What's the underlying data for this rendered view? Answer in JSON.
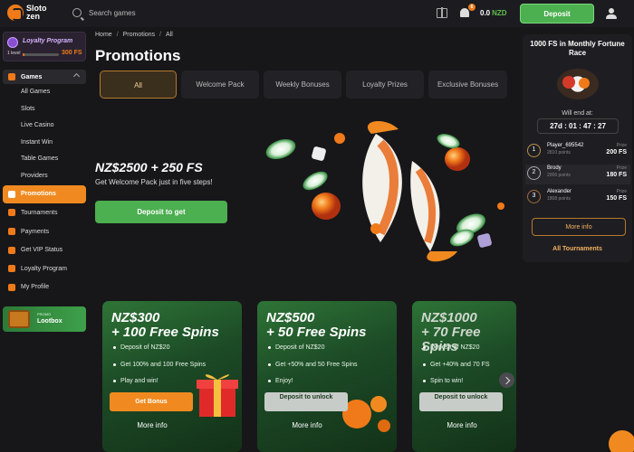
{
  "header": {
    "logo_text": "Sloto zen",
    "search_placeholder": "Search games",
    "notification_count": "6",
    "balance_amount": "0.0",
    "balance_currency": "NZD",
    "deposit_label": "Deposit"
  },
  "loyalty": {
    "title": "Loyalty Program",
    "level": "1 level",
    "points": "300 FS",
    "progress_fraction": 0.05
  },
  "sidebar": {
    "games_label": "Games",
    "game_items": [
      "All Games",
      "Slots",
      "Live Casino",
      "Instant Win",
      "Table Games",
      "Providers"
    ],
    "items": [
      {
        "label": "Promotions",
        "active": true
      },
      {
        "label": "Tournaments",
        "active": false
      },
      {
        "label": "Payments",
        "active": false
      },
      {
        "label": "Get VIP Status",
        "active": false
      },
      {
        "label": "Loyalty Program",
        "active": false
      },
      {
        "label": "My Profile",
        "active": false
      }
    ],
    "lootbox_small": "PROMO",
    "lootbox_label": "Lootbox"
  },
  "breadcrumb": [
    "Home",
    "Promotions",
    "All"
  ],
  "page_title": "Promotions",
  "tabs": [
    {
      "label": "All",
      "active": true
    },
    {
      "label": "Welcome Pack",
      "active": false
    },
    {
      "label": "Weekly Bonuses",
      "active": false
    },
    {
      "label": "Loyalty Prizes",
      "active": false
    },
    {
      "label": "Exclusive Bonuses",
      "active": false
    }
  ],
  "hero": {
    "amount": "NZ$2500 + 250 FS",
    "subtitle": "Get Welcome Pack just in five steps!",
    "button_label": "Deposit to get"
  },
  "race": {
    "title": "1000 FS in Monthly Fortune Race",
    "will_end": "Will end at:",
    "timer": "27d : 01 : 47 : 27",
    "prize_label": "Prize",
    "leaders": [
      {
        "rank": "1",
        "name": "Player_695542",
        "points": "2810 points",
        "prize": "200 FS"
      },
      {
        "rank": "2",
        "name": "Brody",
        "points": "2006 points",
        "prize": "180 FS"
      },
      {
        "rank": "3",
        "name": "Alexander",
        "points": "1808 points",
        "prize": "150 FS"
      }
    ],
    "more_info": "More info",
    "all_tournaments": "All Tournaments"
  },
  "cards": [
    {
      "title_line1": "NZ$300",
      "title_line2": "+ 100 Free Spins",
      "bullets": [
        "Deposit of NZ$20",
        "Get 100% and 100 Free Spins",
        "Play and win!"
      ],
      "button": "Get Bonus",
      "button_style": "orange",
      "more": "More info"
    },
    {
      "title_line1": "NZ$500",
      "title_line2": "+ 50 Free Spins",
      "bullets": [
        "Deposit of NZ$20",
        "Get +50% and 50 Free Spins",
        "Enjoy!"
      ],
      "button": "Deposit to unlock",
      "button_style": "gray",
      "more": "More info"
    },
    {
      "title_line1": "NZ$1000",
      "title_line2": "+ 70 Free Spins",
      "bullets": [
        "Deposit of NZ$20",
        "Get +40% and 70 FS",
        "Spin to win!"
      ],
      "button": "Deposit to unlock",
      "button_style": "gray",
      "more": "More info"
    }
  ],
  "colors": {
    "accent_orange": "#f08a20",
    "accent_green": "#4caf50",
    "background": "#17171a"
  }
}
